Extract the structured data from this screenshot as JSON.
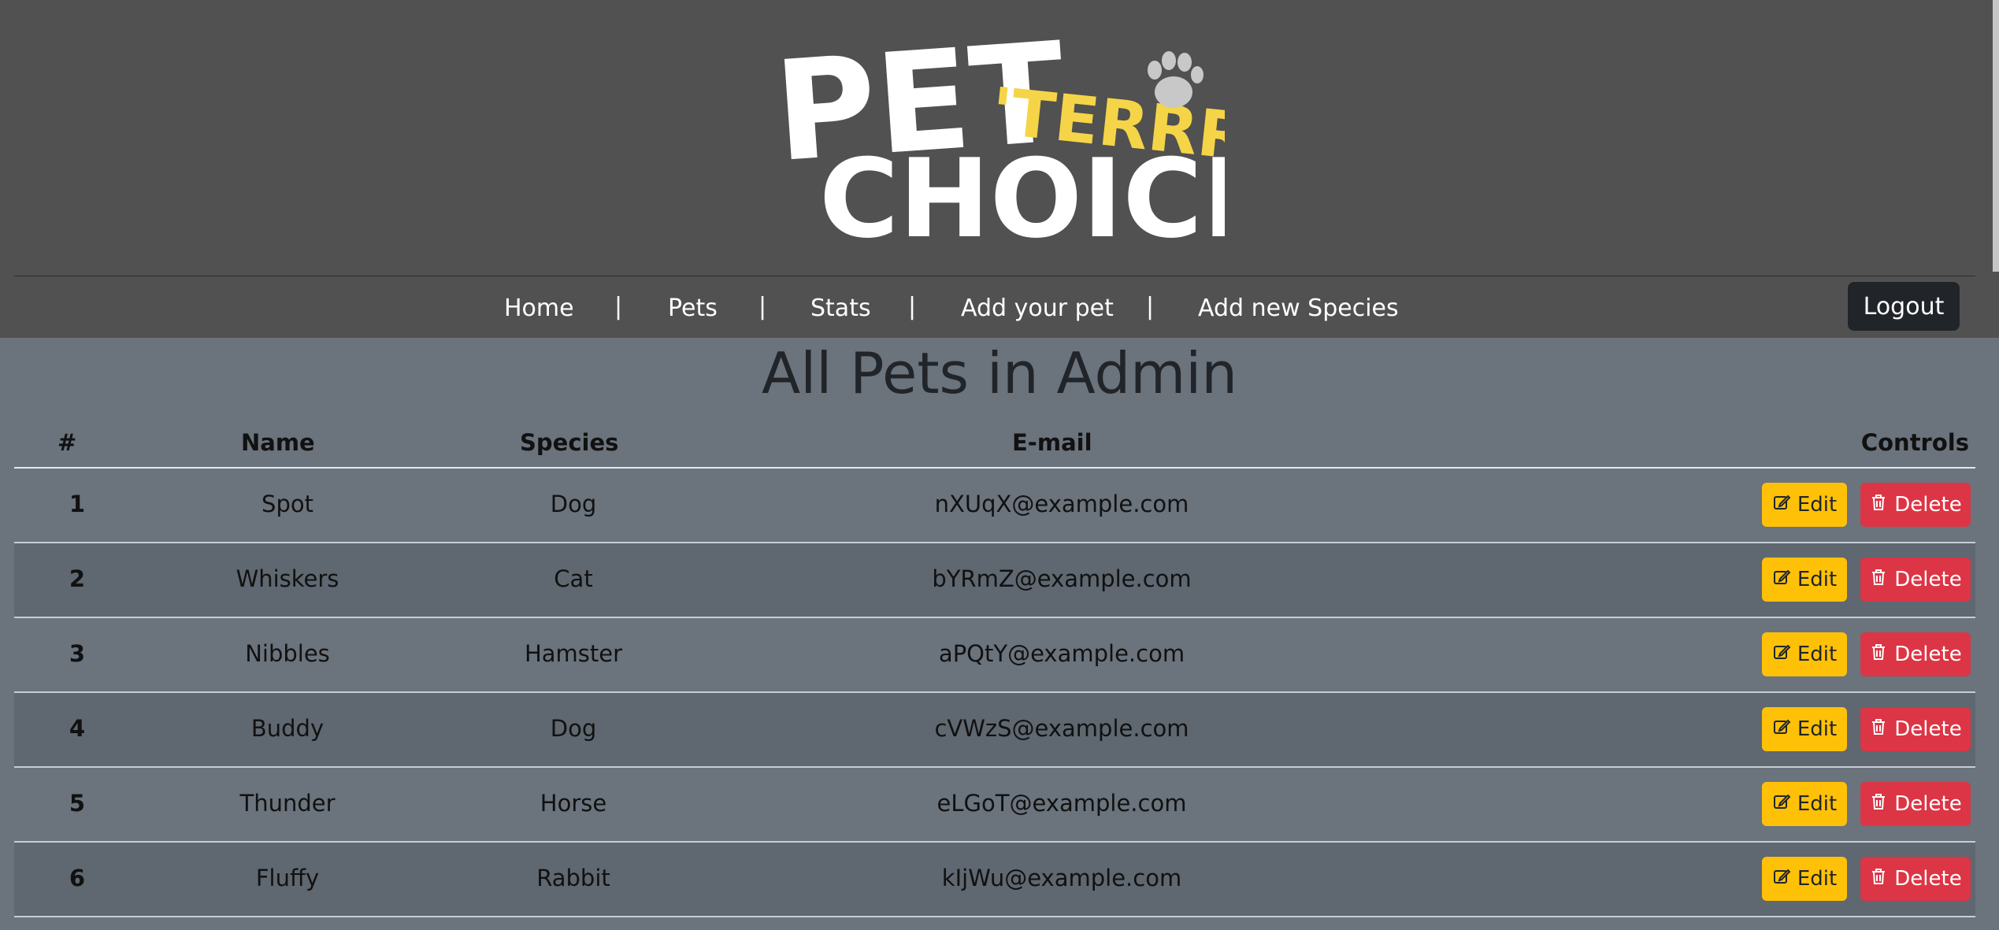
{
  "brand": {
    "logo_text_main": "PET",
    "logo_text_accent": "'TERRR",
    "logo_text_bottom": "CHOICE",
    "logo_icon": "paw-icon",
    "colors": {
      "logo_white": "#ffffff",
      "logo_yellow": "#f5d547",
      "paw_gray": "#c8c8c8"
    }
  },
  "nav": {
    "items": [
      {
        "label": "Home"
      },
      {
        "label": "Pets"
      },
      {
        "label": "Stats"
      },
      {
        "label": "Add your pet"
      },
      {
        "label": "Add new Species"
      }
    ],
    "separator": "|",
    "logout_label": "Logout"
  },
  "main": {
    "title": "All Pets in Admin",
    "table": {
      "headers": {
        "num": "#",
        "name": "Name",
        "species": "Species",
        "email": "E-mail",
        "controls": "Controls"
      },
      "edit_label": "Edit",
      "delete_label": "Delete",
      "edit_icon": "pencil-square-icon",
      "delete_icon": "trash-icon",
      "rows": [
        {
          "num": "1",
          "name": "Spot",
          "species": "Dog",
          "email": "nXUqX@example.com"
        },
        {
          "num": "2",
          "name": "Whiskers",
          "species": "Cat",
          "email": "bYRmZ@example.com"
        },
        {
          "num": "3",
          "name": "Nibbles",
          "species": "Hamster",
          "email": "aPQtY@example.com"
        },
        {
          "num": "4",
          "name": "Buddy",
          "species": "Dog",
          "email": "cVWzS@example.com"
        },
        {
          "num": "5",
          "name": "Thunder",
          "species": "Horse",
          "email": "eLGoT@example.com"
        },
        {
          "num": "6",
          "name": "Fluffy",
          "species": "Rabbit",
          "email": "kIjWu@example.com"
        }
      ]
    },
    "colors": {
      "edit": "#ffc107",
      "delete": "#dc3545",
      "header_bg": "#515151",
      "body_bg": "#6b737d"
    }
  }
}
